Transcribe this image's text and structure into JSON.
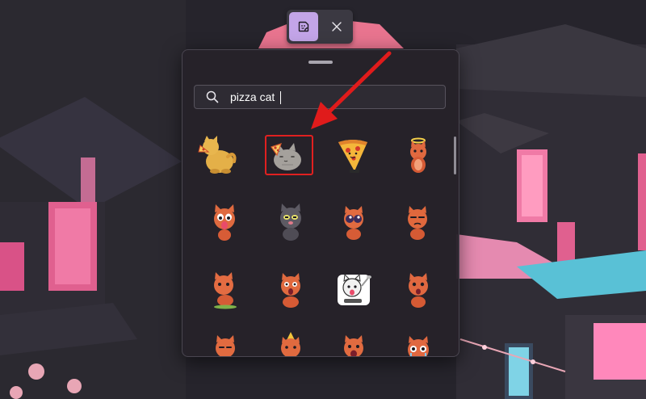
{
  "toolbar": {
    "sticker_tab_icon": "sticker-icon",
    "close_icon": "close-icon",
    "accent_color": "#c3a5e8"
  },
  "search": {
    "icon": "search-icon",
    "value": "pizza cat"
  },
  "stickers": [
    {
      "name": "sticker-1",
      "icon": "cat-eating-pizza"
    },
    {
      "name": "sticker-2",
      "icon": "pusheen-cat-with-pizza",
      "selected": true
    },
    {
      "name": "sticker-3",
      "icon": "pizza-slice"
    },
    {
      "name": "sticker-4",
      "icon": "angel-cat"
    },
    {
      "name": "sticker-5",
      "icon": "cat-tongue-out"
    },
    {
      "name": "sticker-6",
      "icon": "grey-cat-grumpy"
    },
    {
      "name": "sticker-7",
      "icon": "cat-big-eyes"
    },
    {
      "name": "sticker-8",
      "icon": "cat-annoyed"
    },
    {
      "name": "sticker-9",
      "icon": "cat-thinking"
    },
    {
      "name": "sticker-10",
      "icon": "cat-shocked"
    },
    {
      "name": "sticker-11",
      "icon": "white-cat-spoon"
    },
    {
      "name": "sticker-12",
      "icon": "cat-surprised"
    },
    {
      "name": "sticker-13",
      "icon": "cat-smug"
    },
    {
      "name": "sticker-14",
      "icon": "cat-party-hat"
    },
    {
      "name": "sticker-15",
      "icon": "cat-screaming"
    },
    {
      "name": "sticker-16",
      "icon": "cat-crying"
    }
  ],
  "highlight_color": "#e02020"
}
